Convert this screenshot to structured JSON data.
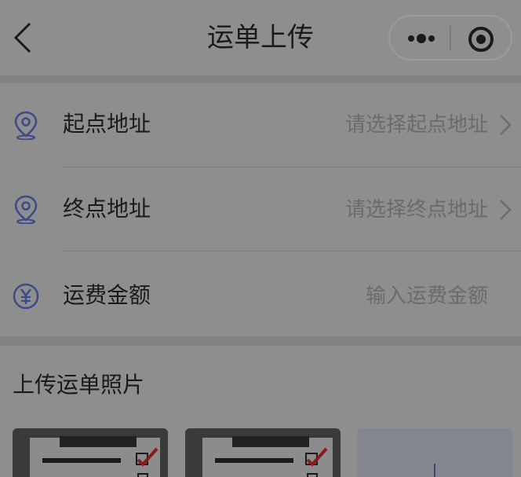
{
  "nav": {
    "title": "运单上传",
    "back_icon": "chevron-left-icon",
    "more_icon": "more-dots-icon",
    "close_icon": "target-circle-icon"
  },
  "form": {
    "rows": [
      {
        "icon": "location-pin-icon",
        "label": "起点地址",
        "placeholder": "请选择起点地址",
        "has_chevron": true
      },
      {
        "icon": "location-pin-icon",
        "label": "终点地址",
        "placeholder": "请选择终点地址",
        "has_chevron": true
      },
      {
        "icon": "yuan-circle-icon",
        "label": "运费金额",
        "placeholder": "输入运费金额",
        "has_chevron": false
      }
    ]
  },
  "photos": {
    "title": "上传运单照片",
    "add_icon": "plus-icon"
  },
  "colors": {
    "icon_accent": "#3b4a8a",
    "checkmark": "#8b1a1a"
  }
}
